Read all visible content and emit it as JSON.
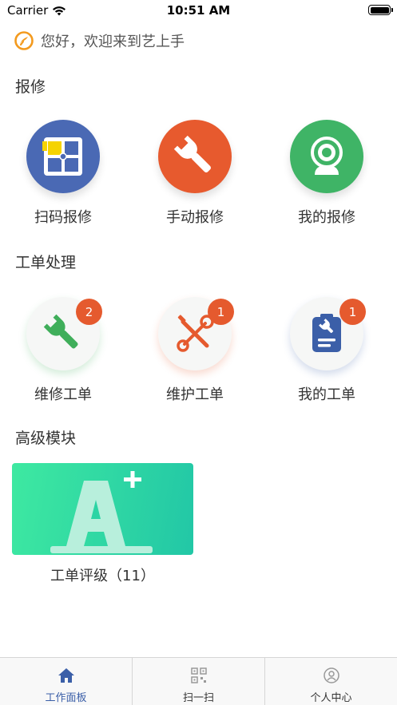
{
  "status_bar": {
    "carrier": "Carrier",
    "time": "10:51 AM"
  },
  "greeting": {
    "text": "您好，欢迎来到艺上手",
    "icon": "orange-logo-icon"
  },
  "sections": {
    "repair": {
      "title": "报修",
      "items": [
        {
          "label": "扫码报修",
          "icon": "scan-code-icon",
          "color": "#4a69b4"
        },
        {
          "label": "手动报修",
          "icon": "wrench-icon",
          "color": "#e75a2e"
        },
        {
          "label": "我的报修",
          "icon": "camera-icon",
          "color": "#3fb466"
        }
      ]
    },
    "work_orders": {
      "title": "工单处理",
      "items": [
        {
          "label": "维修工单",
          "badge": "2",
          "icon": "wrench-icon",
          "color": "#3fae5a"
        },
        {
          "label": "维护工单",
          "badge": "1",
          "icon": "tools-icon",
          "color": "#e55a2e"
        },
        {
          "label": "我的工单",
          "badge": "1",
          "icon": "clipboard-icon",
          "color": "#3b5fa8"
        }
      ]
    },
    "advanced": {
      "title": "高级模块",
      "module": {
        "label": "工单评级（11）",
        "icon": "grade-a-plus-icon"
      }
    }
  },
  "tab_bar": {
    "tabs": [
      {
        "label": "工作面板",
        "icon": "home-icon",
        "active": true
      },
      {
        "label": "扫一扫",
        "icon": "qr-scan-icon",
        "active": false
      },
      {
        "label": "个人中心",
        "icon": "user-icon",
        "active": false
      }
    ],
    "active_color": "#3b5fa8"
  }
}
